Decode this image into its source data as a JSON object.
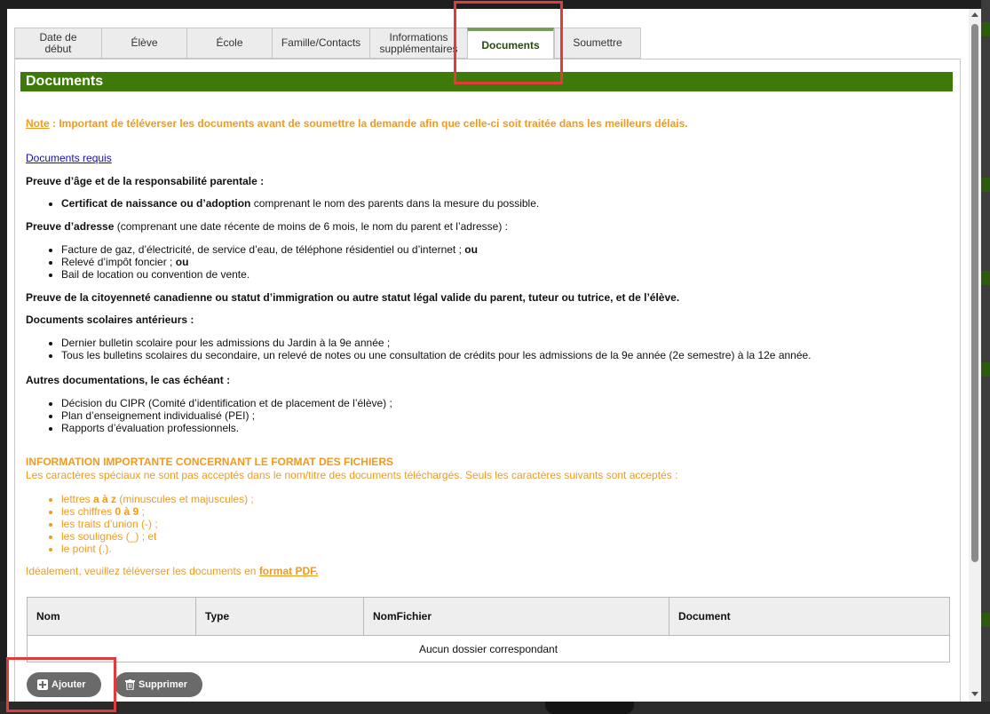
{
  "tabs": [
    {
      "label": "Date de\ndébut"
    },
    {
      "label": "Élève"
    },
    {
      "label": "École"
    },
    {
      "label": "Famille/Contacts"
    },
    {
      "label": "Informations\nsupplémentaires"
    },
    {
      "label": "Documents"
    },
    {
      "label": "Soumettre"
    }
  ],
  "section_title": "Documents",
  "note": {
    "label": "Note",
    "text": " : Important de téléverser les documents avant de soumettre la demande afin que celle-ci soit traitée dans les meilleurs délais."
  },
  "required_link": "Documents requis",
  "age_proof": {
    "heading": "Preuve d’âge et de la responsabilité parentale :",
    "item_bold": "Certificat de naissance ou d’adoption",
    "item_rest": " comprenant le nom des parents dans la mesure du possible."
  },
  "address_proof": {
    "heading_bold": "Preuve d’adresse",
    "heading_rest": " (comprenant une date récente de moins de 6 mois, le nom du parent et l’adresse) :",
    "items": [
      {
        "text": "Facture de gaz, d’électricité, de service d’eau, de téléphone résidentiel ou d’internet ; ",
        "bold": "ou"
      },
      {
        "text": "Relevé d’impôt foncier ; ",
        "bold": "ou"
      },
      {
        "text": "Bail de location ou convention de vente.",
        "bold": ""
      }
    ]
  },
  "citizenship": "Preuve de la citoyenneté canadienne ou statut d’immigration ou autre statut légal valide du parent, tuteur ou tutrice, et de l’élève.",
  "school_docs": {
    "heading": "Documents scolaires antérieurs :",
    "items": [
      "Dernier bulletin scolaire pour les admissions du Jardin à la 9e année ;",
      "Tous les bulletins scolaires du secondaire, un relevé de notes ou une consultation de crédits pour les admissions de la 9e année (2e semestre) à la 12e année."
    ]
  },
  "other_docs": {
    "heading": "Autres documentations, le cas échéant :",
    "items": [
      "Décision du CIPR (Comité d’identification et de placement de l’élève) ;",
      "Plan d’enseignement individualisé (PEI) ;",
      "Rapports d’évaluation professionnels."
    ]
  },
  "file_format": {
    "heading": "INFORMATION IMPORTANTE CONCERNANT LE FORMAT DES FICHIERS",
    "intro": "Les caractères spéciaux ne sont pas acceptés dans le nom/titre des documents téléchargés. Seuls les caractères suivants sont acceptés :",
    "items": [
      {
        "pre": "lettres ",
        "bold": "a à z",
        "post": " (minuscules et majuscules) ;"
      },
      {
        "pre": "les chiffres ",
        "bold": "0 à 9",
        "post": " ;"
      },
      {
        "pre": "les traits d’union (-) ;",
        "bold": "",
        "post": ""
      },
      {
        "pre": "les soulignés (_) ; et",
        "bold": "",
        "post": ""
      },
      {
        "pre": "le point (.).",
        "bold": "",
        "post": ""
      }
    ],
    "pdf_pre": "Idéalement, veuillez téléverser les documents en ",
    "pdf_link": "format PDF."
  },
  "table": {
    "headers": [
      "Nom",
      "Type",
      "NomFichier",
      "Document"
    ],
    "empty_message": "Aucun dossier correspondant"
  },
  "buttons": {
    "add": "Ajouter",
    "delete": "Supprimer"
  },
  "colors": {
    "header_green": "#3d7a0a",
    "note_orange": "#f29a1d",
    "annotation_red": "#e23b3b"
  }
}
